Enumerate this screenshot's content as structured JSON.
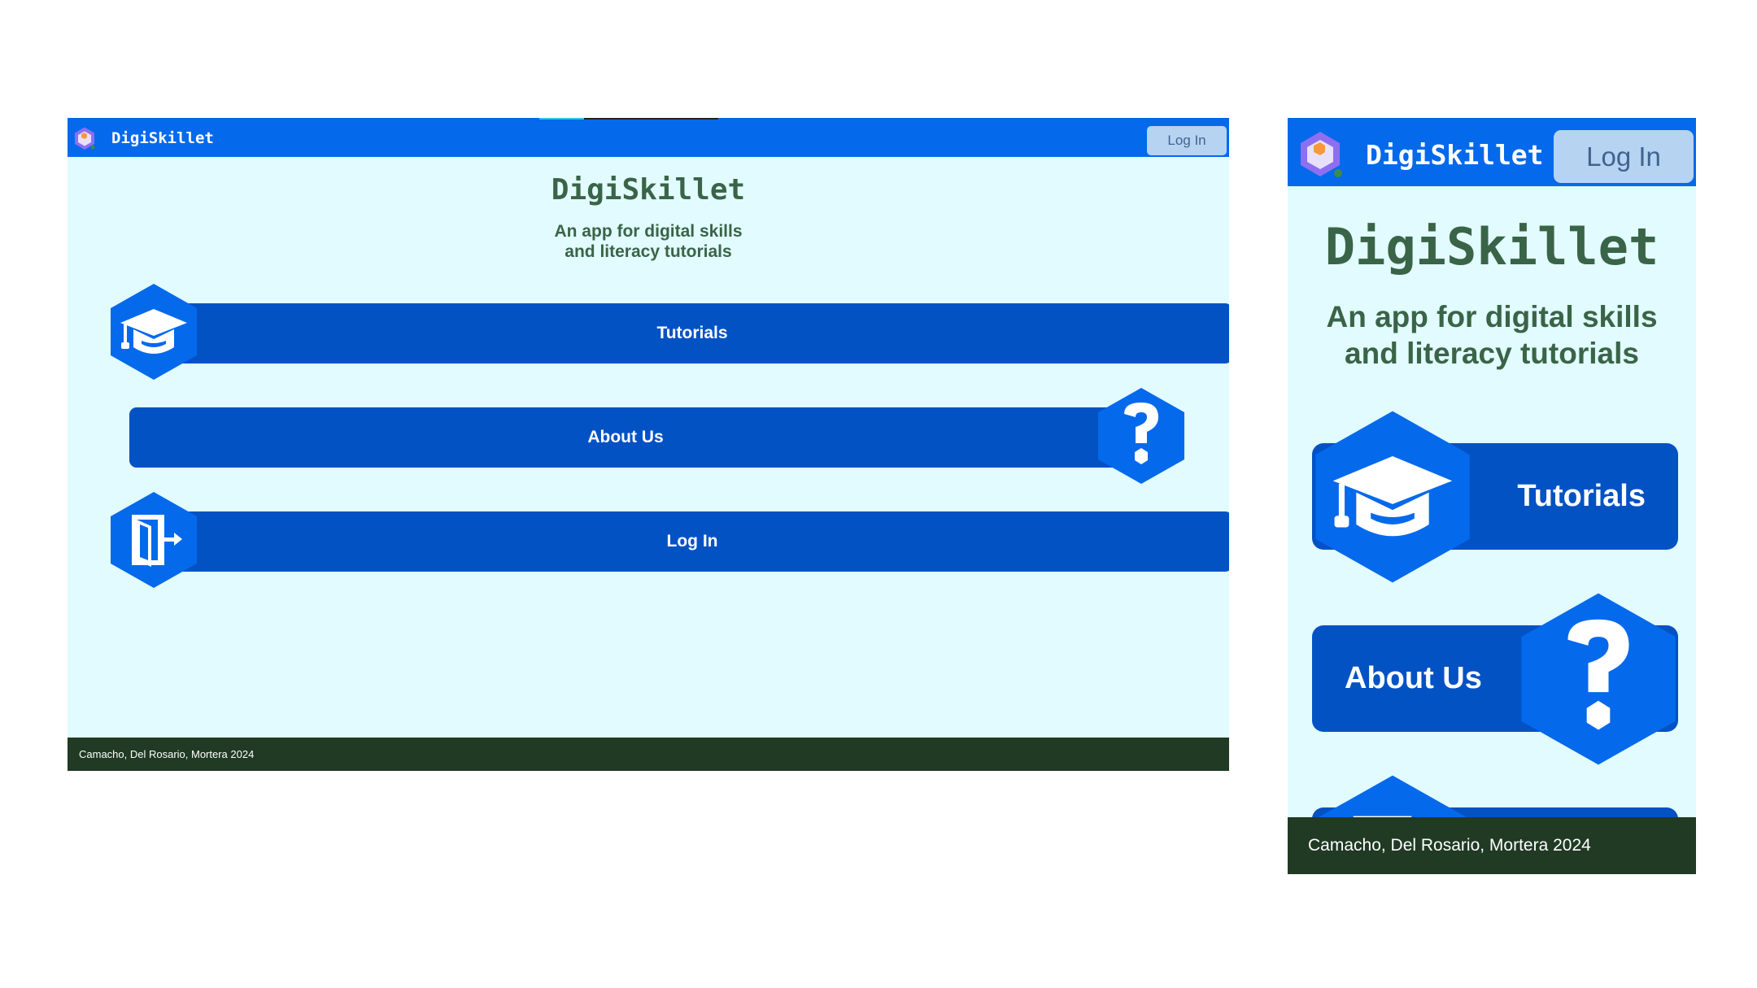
{
  "desktop": {
    "brand": "DigiSkillet",
    "nav_login_label": "Log In",
    "title": "DigiSkillet",
    "subtitle_line1": "An app for digital skills",
    "subtitle_line2": "and literacy tutorials",
    "menu": [
      {
        "label": "Tutorials",
        "icon": "graduation-cap-icon"
      },
      {
        "label": "About Us",
        "icon": "question-mark-icon"
      },
      {
        "label": "Log In",
        "icon": "door-exit-icon"
      }
    ],
    "footer": "Camacho, Del Rosario, Mortera 2024"
  },
  "mobile": {
    "brand": "DigiSkillet",
    "nav_login_label": "Log In",
    "title": "DigiSkillet",
    "subtitle_line1": "An app for digital skills",
    "subtitle_line2": "and literacy tutorials",
    "menu": [
      {
        "label": "Tutorials",
        "icon": "graduation-cap-icon"
      },
      {
        "label": "About Us",
        "icon": "question-mark-icon"
      }
    ],
    "footer": "Camacho, Del Rosario, Mortera 2024"
  },
  "colors": {
    "nav_blue": "#0569ec",
    "button_blue": "#0352c4",
    "background": "#e1fbfe",
    "title_green": "#3a6447",
    "footer_green": "#203a24",
    "login_button_bg": "#b6d3f2"
  }
}
